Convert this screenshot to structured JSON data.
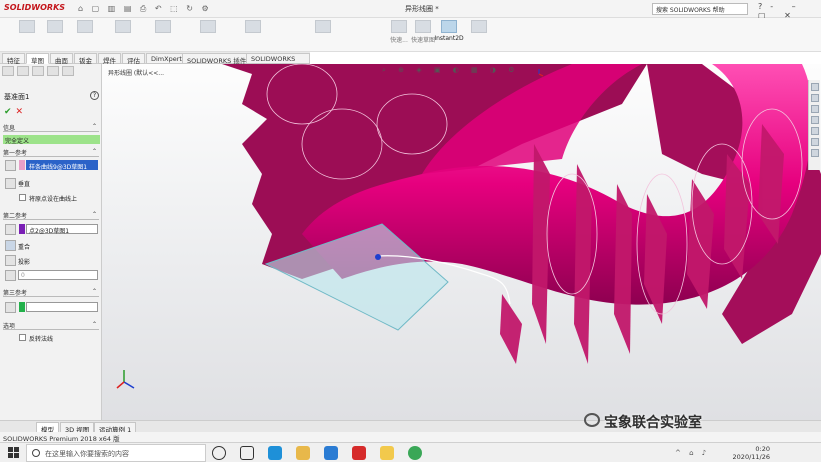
{
  "app": {
    "logo": "SOLIDWORKS",
    "quick_access_icons": [
      "home-icon",
      "new-icon",
      "open-icon",
      "save-icon",
      "print-icon",
      "undo-icon",
      "select-icon",
      "rebuild-icon",
      "options-icon"
    ],
    "doc_title": "异形线圈 *",
    "search_placeholder": "搜索 SOLIDWORKS 帮助",
    "window_controls": [
      "minimize-icon",
      "restore-icon",
      "close-icon"
    ]
  },
  "ribbon": {
    "buttons": [
      {
        "label": "",
        "state": "disabled"
      },
      {
        "label": "",
        "state": "disabled"
      },
      {
        "label": "",
        "state": "disabled"
      },
      {
        "label": "",
        "state": "disabled"
      },
      {
        "label": "",
        "state": "disabled"
      },
      {
        "label": "",
        "state": "disabled"
      },
      {
        "label": "",
        "state": "disabled"
      },
      {
        "label": "",
        "state": "disabled"
      },
      {
        "label": "快速...",
        "state": "normal"
      },
      {
        "label": "快速草图",
        "state": "normal"
      },
      {
        "label": "Instant2D",
        "state": "active"
      },
      {
        "label": "",
        "state": "disabled"
      }
    ]
  },
  "command_tabs": [
    "特征",
    "草图",
    "曲面",
    "钣金",
    "焊件",
    "评估",
    "DimXpert",
    "SOLIDWORKS 插件",
    "SOLIDWORKS MBD"
  ],
  "command_tab_active": 1,
  "panel": {
    "title": "基准面1",
    "info_section": "信息",
    "message": "完全定义",
    "first_ref": {
      "header": "第一参考",
      "value": "样条曲线9@3D草图1",
      "swatch": "#e8a0c8",
      "options": [
        "垂直",
        "将原点设在曲线上"
      ]
    },
    "second_ref": {
      "header": "第二参考",
      "value": "点2@3D草图1",
      "swatch": "#7a1fb5",
      "options": [
        "重合",
        "投影"
      ],
      "angle_value": "0"
    },
    "third_ref": {
      "header": "第三参考",
      "value": "",
      "swatch": "#22b04a"
    },
    "options_header": "选项",
    "flip_label": "反转法线"
  },
  "viewport": {
    "tree_label": "异形线圈 (默认<<...",
    "view_tool_icons": [
      "search-icon",
      "zoom-icon",
      "view-icon",
      "display-icon",
      "section-icon",
      "scene-icon",
      "render-icon",
      "settings-icon"
    ]
  },
  "model_tabs": [
    "模型",
    "3D 视图",
    "运动算例 1"
  ],
  "model_tab_active": 0,
  "status_text": "SOLIDWORKS Premium 2018 x64 版",
  "watermark": "宝象联合实验室",
  "taskbar": {
    "search_placeholder": "在这里输入你要搜索的内容",
    "time": "0:20",
    "date": "2020/11/26"
  },
  "colors": {
    "torus": "#e6007e",
    "torus_dark": "#a8005a",
    "fin": "#c2186b",
    "sketch_plane": "#b9e6ec",
    "panel_message": "#9de38a"
  }
}
